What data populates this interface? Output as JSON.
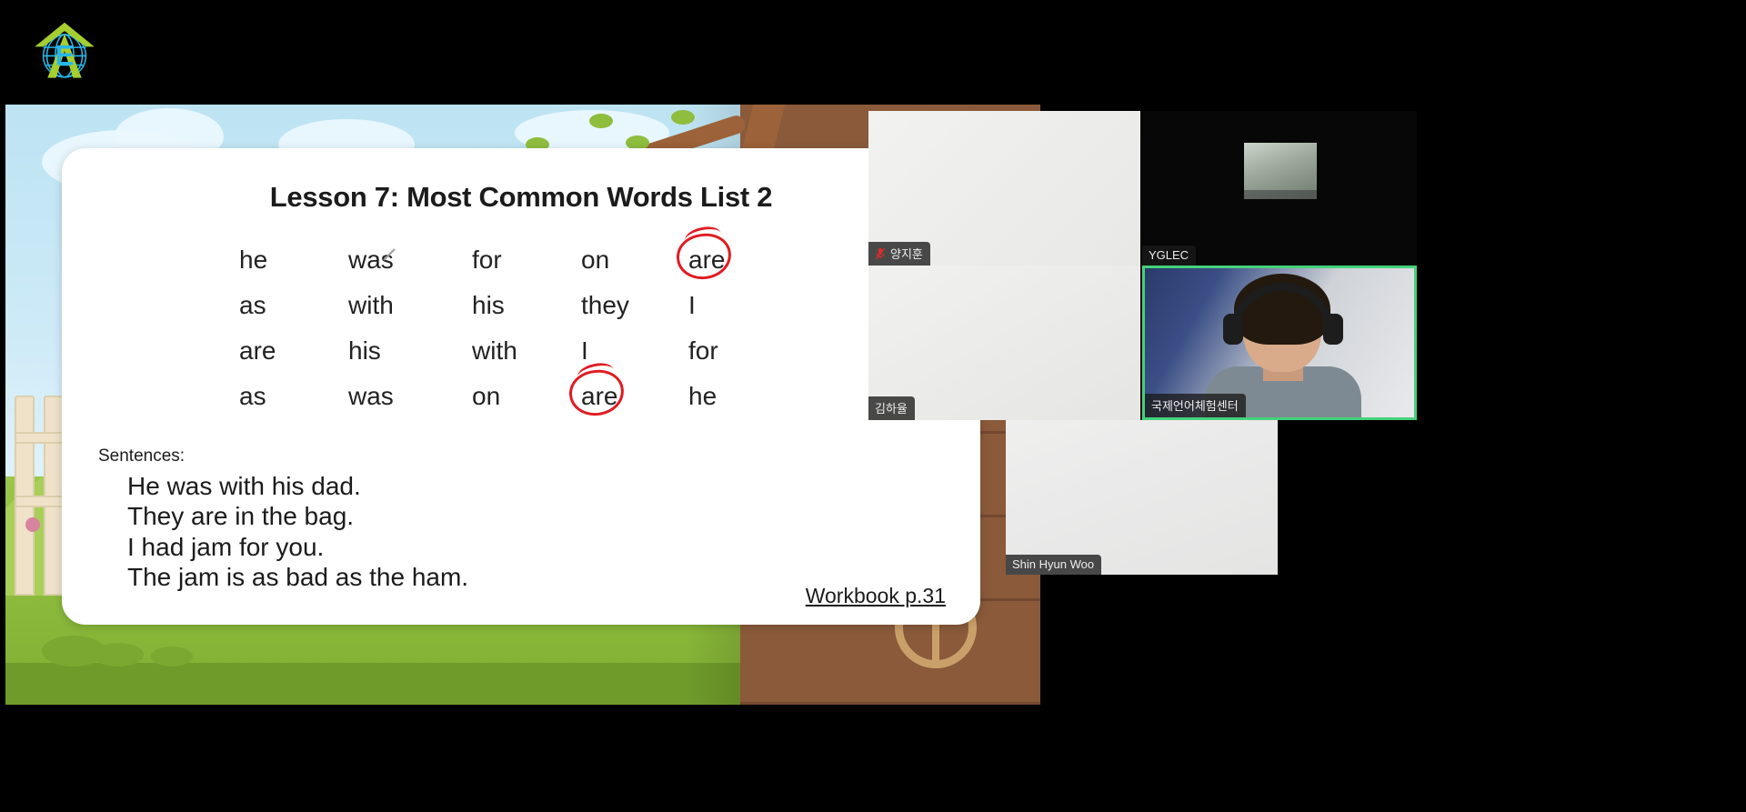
{
  "app": {
    "background_color": "#000000",
    "logo_name": "yglec-logo"
  },
  "slide": {
    "title": "Lesson 7: Most Common Words List 2",
    "word_grid": {
      "rows": [
        [
          "he",
          "was",
          "for",
          "on",
          "are"
        ],
        [
          "as",
          "with",
          "his",
          "they",
          "I"
        ],
        [
          "are",
          "his",
          "with",
          "I",
          "for"
        ],
        [
          "as",
          "was",
          "on",
          "are",
          "he"
        ]
      ],
      "circled_cells": [
        {
          "row": 0,
          "col": 4,
          "word": "are"
        },
        {
          "row": 3,
          "col": 3,
          "word": "are"
        }
      ],
      "annotation_color": "#e11b22"
    },
    "sentences_label": "Sentences:",
    "sentences": [
      "He was with his dad.",
      "They are in the bag.",
      "I had jam for you.",
      "The jam is as bad as the ham."
    ],
    "workbook_link": "Workbook p.31"
  },
  "video_panel": {
    "active_speaker_color": "#45d27a",
    "tiles": [
      {
        "id": "yangjihun",
        "name": "양지훈",
        "muted": true
      },
      {
        "id": "yglec",
        "name": "YGLEC",
        "muted": false
      },
      {
        "id": "kimhayul",
        "name": "김하율",
        "muted": false
      },
      {
        "id": "teacher",
        "name": "국제언어체험센터",
        "muted": false,
        "active_speaker": true
      },
      {
        "id": "shinhyunwoo",
        "name": "Shin Hyun Woo",
        "muted": false
      }
    ]
  }
}
